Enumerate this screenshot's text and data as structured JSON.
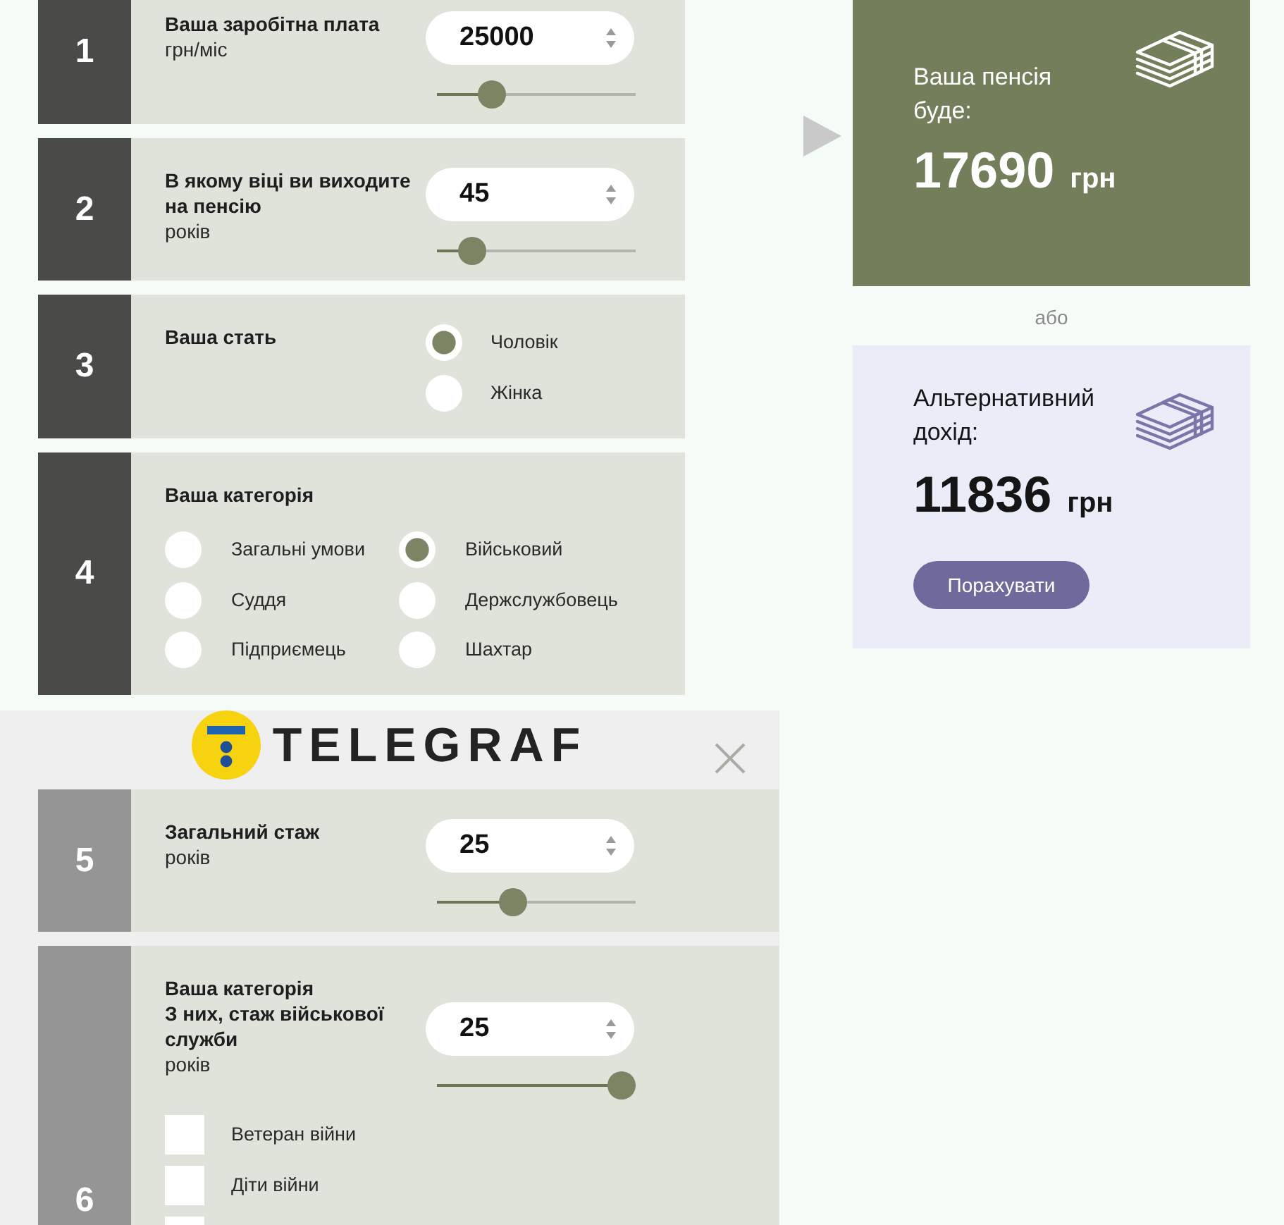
{
  "steps": [
    {
      "number": "1",
      "kind": "number",
      "titles": [
        "Ваша заробітна плата"
      ],
      "unit": "грн/міс",
      "value": "25000",
      "level": 0.24
    },
    {
      "number": "2",
      "kind": "number",
      "titles": [
        "В якому віці ви виходите на пенсію"
      ],
      "unit": "років",
      "value": "45",
      "level": 0.12
    },
    {
      "number": "3",
      "kind": "radio",
      "titles": [
        "Ваша стать"
      ],
      "options": [
        {
          "label": "Чоловік",
          "selected": true
        },
        {
          "label": "Жінка",
          "selected": false
        }
      ]
    },
    {
      "number": "4",
      "kind": "radio-grid",
      "titles": [
        "Ваша категорія"
      ],
      "options": [
        {
          "label": "Загальні умови",
          "selected": false
        },
        {
          "label": "Військовий",
          "selected": true
        },
        {
          "label": "Суддя",
          "selected": false
        },
        {
          "label": "Держслужбовець",
          "selected": false
        },
        {
          "label": "Підприємець",
          "selected": false
        },
        {
          "label": "Шахтар",
          "selected": false
        }
      ]
    }
  ],
  "result": {
    "title": "Ваша пенсія буде:",
    "amount": "17690",
    "currency": "грн"
  },
  "separator": "або",
  "alternative": {
    "title": "Альтернативний дохід:",
    "amount": "11836",
    "currency": "грн",
    "button": "Порахувати"
  },
  "banner": {
    "logo": "TELEGRAF",
    "steps": [
      {
        "number": "5",
        "kind": "number",
        "titles": [
          "Загальний стаж"
        ],
        "unit": "років",
        "value": "25",
        "level": 0.36
      },
      {
        "number": "6",
        "kind": "number",
        "titles": [
          "Ваша категорія",
          "З них, стаж військової служби"
        ],
        "unit": "років",
        "value": "25",
        "level": 1,
        "checkboxes": [
          {
            "label": "Ветеран війни",
            "checked": false
          },
          {
            "label": "Діти війни",
            "checked": false
          },
          {
            "checked": false
          }
        ]
      }
    ]
  }
}
